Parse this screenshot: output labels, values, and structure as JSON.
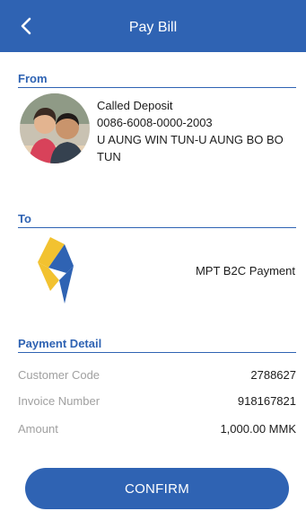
{
  "header": {
    "title": "Pay Bill",
    "back_icon": "chevron-left-icon"
  },
  "from": {
    "section_title": "From",
    "account_type": "Called Deposit",
    "account_number": "0086-6008-0000-2003",
    "account_name": "U AUNG WIN TUN-U AUNG BO BO TUN"
  },
  "to": {
    "section_title": "To",
    "payee": "MPT B2C Payment"
  },
  "payment_detail": {
    "section_title": "Payment Detail",
    "rows": [
      {
        "label": "Customer Code",
        "value": "2788627"
      },
      {
        "label": "Invoice Number",
        "value": "918167821"
      },
      {
        "label": "Amount",
        "value": "1,000.00 MMK"
      }
    ]
  },
  "confirm_label": "CONFIRM",
  "colors": {
    "primary": "#2f63b3",
    "logo_yellow": "#f2c230",
    "logo_blue": "#2f63b3"
  }
}
